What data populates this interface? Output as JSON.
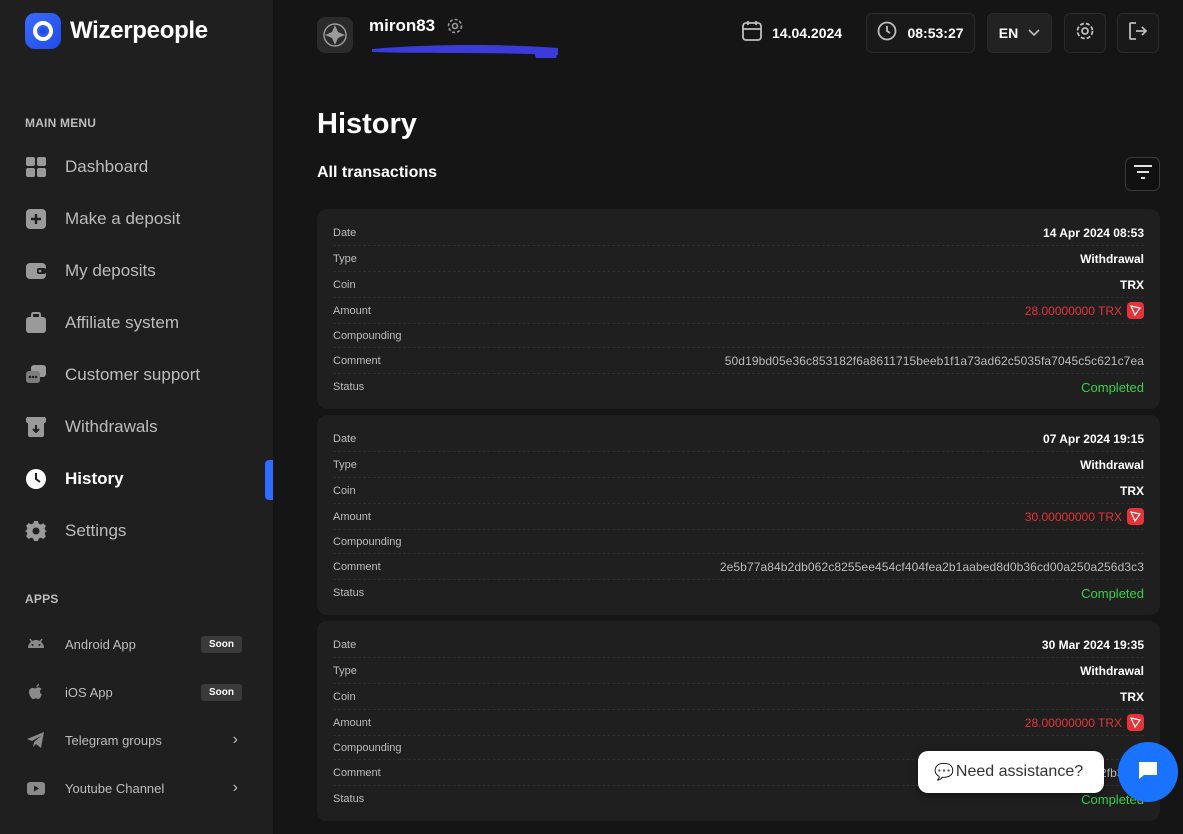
{
  "brand": {
    "name": "Wizerpeople"
  },
  "sidebar": {
    "main_menu_title": "MAIN MENU",
    "items": [
      {
        "label": "Dashboard",
        "icon": "grid-icon"
      },
      {
        "label": "Make a deposit",
        "icon": "plus-square-icon"
      },
      {
        "label": "My deposits",
        "icon": "wallet-icon"
      },
      {
        "label": "Affiliate system",
        "icon": "briefcase-icon"
      },
      {
        "label": "Customer support",
        "icon": "chat-bubbles-icon"
      },
      {
        "label": "Withdrawals",
        "icon": "withdraw-icon"
      },
      {
        "label": "History",
        "icon": "clock-icon",
        "active": true
      },
      {
        "label": "Settings",
        "icon": "gear-icon"
      }
    ],
    "apps_title": "APPS",
    "apps": [
      {
        "label": "Android App",
        "badge": "Soon",
        "icon": "android-icon"
      },
      {
        "label": "iOS App",
        "badge": "Soon",
        "icon": "apple-icon"
      },
      {
        "label": "Telegram groups",
        "icon": "telegram-icon"
      },
      {
        "label": "Youtube Channel",
        "icon": "youtube-icon"
      }
    ]
  },
  "header": {
    "username": "miron83",
    "date": "14.04.2024",
    "time": "08:53:27",
    "language": "EN"
  },
  "main": {
    "title": "History",
    "subtitle": "All transactions",
    "field_labels": {
      "date": "Date",
      "type": "Type",
      "coin": "Coin",
      "amount": "Amount",
      "compounding": "Compounding",
      "comment": "Comment",
      "status": "Status"
    },
    "transactions": [
      {
        "date": "14 Apr 2024 08:53",
        "type": "Withdrawal",
        "coin": "TRX",
        "amount": "28.00000000 TRX",
        "compounding": "",
        "comment": "50d19bd05e36c853182f6a8611715beeb1f1a73ad62c5035fa7045c5c621c7ea",
        "status": "Completed"
      },
      {
        "date": "07 Apr 2024 19:15",
        "type": "Withdrawal",
        "coin": "TRX",
        "amount": "30.00000000 TRX",
        "compounding": "",
        "comment": "2e5b77a84b2db062c8255ee454cf404fea2b1aabed8d0b36cd00a250a256d3c3",
        "status": "Completed"
      },
      {
        "date": "30 Mar 2024 19:35",
        "type": "Withdrawal",
        "coin": "TRX",
        "amount": "28.00000000 TRX",
        "compounding": "",
        "comment": "1d2dd2bfd22c3715c94ff98b462fb37b6",
        "status": "Completed"
      }
    ]
  },
  "chat": {
    "assist_label": "Need assistance?"
  },
  "colors": {
    "accent": "#2f6bff",
    "negative": "#e6333a",
    "positive": "#36d24a",
    "background": "#151515",
    "panel": "#1f1f1f"
  }
}
